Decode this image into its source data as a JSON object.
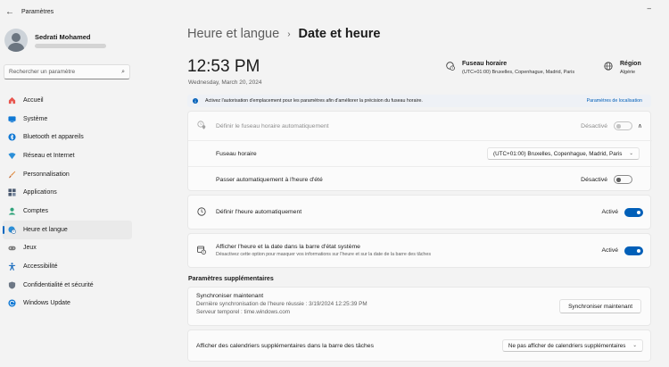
{
  "window": {
    "title": "Paramètres",
    "back_icon": "back-arrow-icon",
    "minimize_icon": "minimize-icon"
  },
  "profile": {
    "name": "Sedrati Mohamed"
  },
  "search": {
    "placeholder": "Rechercher un paramètre",
    "icon": "search-icon"
  },
  "sidebar": {
    "items": [
      {
        "label": "Accueil",
        "icon": "home-icon",
        "color": "#e8554e"
      },
      {
        "label": "Système",
        "icon": "monitor-icon",
        "color": "#0f78d4"
      },
      {
        "label": "Bluetooth et appareils",
        "icon": "bluetooth-icon",
        "color": "#0f78d4"
      },
      {
        "label": "Réseau et Internet",
        "icon": "wifi-icon",
        "color": "#2b8fd8"
      },
      {
        "label": "Personnalisation",
        "icon": "brush-icon",
        "color": "#e08a3c"
      },
      {
        "label": "Applications",
        "icon": "apps-icon",
        "color": "#4a5a70"
      },
      {
        "label": "Comptes",
        "icon": "account-icon",
        "color": "#2fa37a"
      },
      {
        "label": "Heure et langue",
        "icon": "globe-clock-icon",
        "color": "#2b8fd8",
        "active": true
      },
      {
        "label": "Jeux",
        "icon": "gamepad-icon",
        "color": "#7a7a7a"
      },
      {
        "label": "Accessibilité",
        "icon": "accessibility-icon",
        "color": "#1f6fbf"
      },
      {
        "label": "Confidentialité et sécurité",
        "icon": "shield-icon",
        "color": "#6d7785"
      },
      {
        "label": "Windows Update",
        "icon": "update-icon",
        "color": "#0f78d4"
      }
    ]
  },
  "breadcrumb": {
    "parent": "Heure et langue",
    "separator": "›",
    "current": "Date et heure"
  },
  "clock": {
    "time": "12:53 PM",
    "date": "Wednesday, March 20, 2024"
  },
  "timezone": {
    "title": "Fuseau horaire",
    "value": "(UTC+01:00) Bruxelles, Copenhague, Madrid, Paris",
    "icon": "globe-clock-icon"
  },
  "region": {
    "title": "Région",
    "value": "Algérie",
    "icon": "globe-icon"
  },
  "info_bar": {
    "text": "Activez l'autorisation d'emplacement pour les paramètres afin d'améliorer la précision du fuseau horaire.",
    "link": "Paramètres de localisation",
    "icon": "info-icon"
  },
  "auto_timezone": {
    "label": "Définir le fuseau horaire automatiquement",
    "state": "Désactivé",
    "icon": "location-clock-icon",
    "chevron": "chevron-up-icon"
  },
  "timezone_row": {
    "label": "Fuseau horaire",
    "selected": "(UTC+01:00) Bruxelles, Copenhague, Madrid, Paris",
    "caret": "⌄"
  },
  "dst_row": {
    "label": "Passer automatiquement à l'heure d'été",
    "state": "Désactivé"
  },
  "auto_time": {
    "label": "Définir l'heure automatiquement",
    "state": "Activé",
    "icon": "clock-icon"
  },
  "systray": {
    "label": "Afficher l'heure et la date dans la barre d'état système",
    "sub": "Désactivez cette option pour masquer vos informations sur l'heure et sur la date de la barre des tâches",
    "state": "Activé",
    "icon": "calendar-clock-icon"
  },
  "additional": {
    "title": "Paramètres supplémentaires",
    "sync_title": "Synchroniser maintenant",
    "sync_last": "Dernière synchronisation de l'heure réussie : 3/19/2024 12:25:39 PM",
    "sync_server": "Serveur temporel : time.windows.com",
    "sync_button": "Synchroniser maintenant",
    "calendars_label": "Afficher des calendriers supplémentaires dans la barre des tâches",
    "calendars_selected": "Ne pas afficher de calendriers supplémentaires"
  },
  "colors": {
    "accent": "#005fb8",
    "background": "#f3f3f3",
    "card": "#fbfbfb"
  }
}
